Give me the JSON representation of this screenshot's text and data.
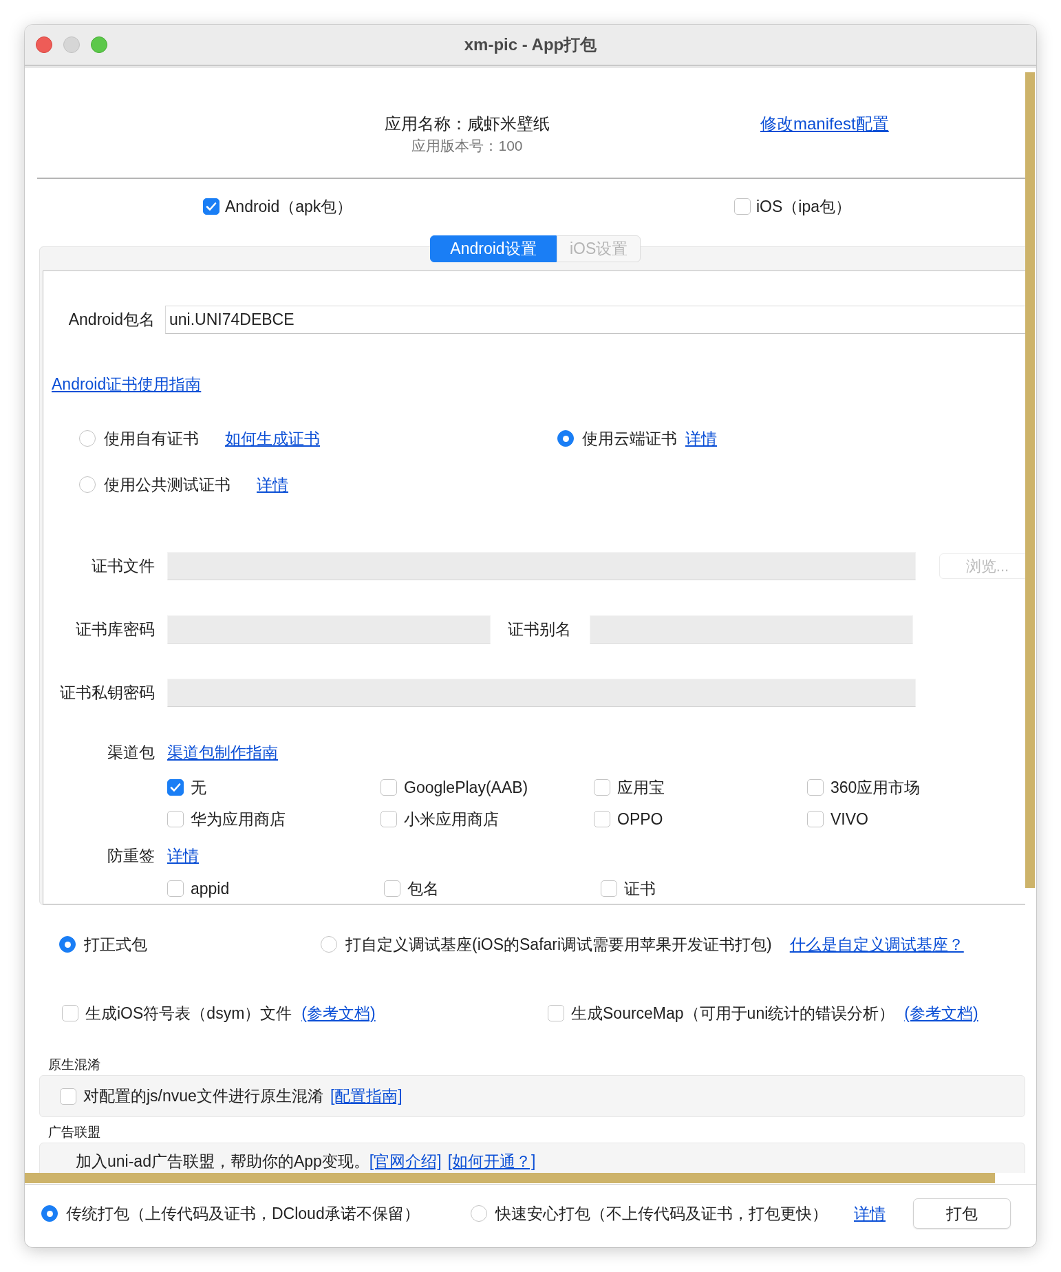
{
  "window": {
    "title": "xm-pic - App打包"
  },
  "app": {
    "name": "应用名称：咸虾米壁纸",
    "version": "应用版本号：100",
    "manifest_link": "修改manifest配置"
  },
  "platforms": [
    {
      "label": "Android（apk包）",
      "checked": true
    },
    {
      "label": "iOS（ipa包）",
      "checked": false
    }
  ],
  "tabs": [
    {
      "label": "Android设置",
      "selected": true
    },
    {
      "label": "iOS设置",
      "selected": false
    }
  ],
  "android": {
    "package_name": {
      "label": "Android包名",
      "value": "uni.UNI74DEBCE"
    },
    "cert_guide_link": "Android证书使用指南",
    "cert_options": [
      {
        "label": "使用自有证书",
        "link": "如何生成证书",
        "selected": false
      },
      {
        "label": "使用云端证书",
        "link": "详情",
        "selected": true
      },
      {
        "label": "使用公共测试证书",
        "link": "详情",
        "selected": false
      }
    ],
    "cert_fields_disabled": true,
    "cert_file": {
      "label": "证书文件",
      "browse_button": "浏览..."
    },
    "keystore_password": {
      "label": "证书库密码"
    },
    "alias": {
      "label": "证书别名"
    },
    "private_key_password": {
      "label": "证书私钥密码"
    },
    "channels": {
      "label": "渠道包",
      "link": "渠道包制作指南",
      "items": [
        {
          "label": "无",
          "checked": true
        },
        {
          "label": "GooglePlay(AAB)",
          "checked": false
        },
        {
          "label": "应用宝",
          "checked": false
        },
        {
          "label": "360应用市场",
          "checked": false
        },
        {
          "label": "华为应用商店",
          "checked": false
        },
        {
          "label": "小米应用商店",
          "checked": false
        },
        {
          "label": "OPPO",
          "checked": false
        },
        {
          "label": "VIVO",
          "checked": false
        }
      ]
    },
    "anti_resign": {
      "label": "防重签",
      "link": "详情",
      "items": [
        {
          "label": "appid",
          "checked": false
        },
        {
          "label": "包名",
          "checked": false
        },
        {
          "label": "证书",
          "checked": false
        }
      ]
    }
  },
  "build_types": [
    {
      "label": "打正式包",
      "selected": true
    },
    {
      "label": "打自定义调试基座(iOS的Safari调试需要用苹果开发证书打包)",
      "selected": false,
      "link": "什么是自定义调试基座？"
    }
  ],
  "extras": [
    {
      "label": "生成iOS符号表（dsym）文件",
      "link": "(参考文档)",
      "checked": false
    },
    {
      "label": "生成SourceMap（可用于uni统计的错误分析）",
      "link": "(参考文档)",
      "checked": false
    }
  ],
  "native_obfuscation": {
    "title": "原生混淆",
    "label": "对配置的js/nvue文件进行原生混淆",
    "link": "[配置指南]",
    "checked": false
  },
  "ad_alliance": {
    "title": "广告联盟",
    "text": "加入uni-ad广告联盟，帮助你的App变现。",
    "links": [
      "[官网介绍]",
      "[如何开通？]"
    ]
  },
  "pack_modes": [
    {
      "label": "传统打包（上传代码及证书，DCloud承诺不保留）",
      "selected": true
    },
    {
      "label": "快速安心打包（不上传代码及证书，打包更快）",
      "selected": false
    }
  ],
  "details_link": "详情",
  "pack_button": "打包"
}
